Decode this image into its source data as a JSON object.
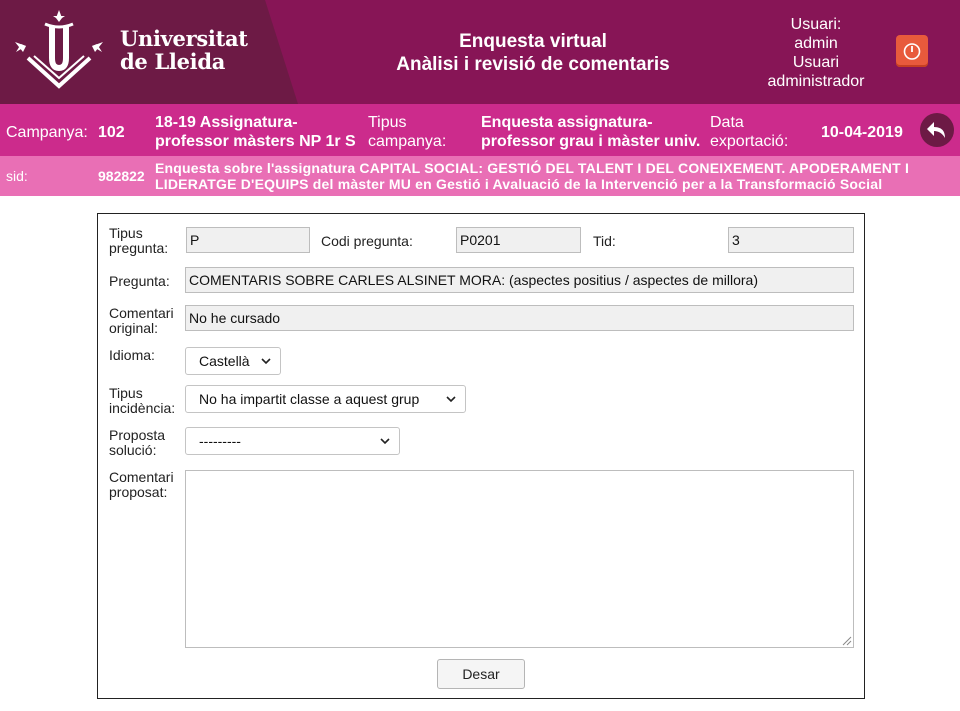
{
  "header": {
    "logo": {
      "line1": "Universitat",
      "line2": "de Lleida"
    },
    "title_line1": "Enquesta virtual",
    "title_line2": "Anàlisi i revisió de comentaris",
    "user": {
      "label": "Usuari:",
      "name": "admin",
      "role_line1": "Usuari",
      "role_line2": "administrador"
    },
    "logout_icon": "power-icon"
  },
  "campaign": {
    "label": "Campanya:",
    "number": "102",
    "name_line1": "18-19 Assignatura-",
    "name_line2": "professor màsters NP 1r S",
    "type_label_line1": "Tipus",
    "type_label_line2": "campanya:",
    "type_value_line1": "Enquesta assignatura-",
    "type_value_line2": "professor grau i màster univ.",
    "export_label_line1": "Data",
    "export_label_line2": "exportació:",
    "export_date": "10-04-2019",
    "back_icon": "back-arrow-icon"
  },
  "sid": {
    "label": "sid:",
    "value": "982822",
    "description": "Enquesta sobre l'assignatura CAPITAL SOCIAL: GESTIÓ DEL TALENT I DEL CONEIXEMENT. APODERAMENT I LIDERATGE D'EQUIPS del màster MU en Gestió i Avaluació de la Intervenció per a la Transformació Social"
  },
  "form": {
    "tipus_pregunta_label_line1": "Tipus",
    "tipus_pregunta_label_line2": "pregunta:",
    "tipus_pregunta_value": "P",
    "codi_pregunta_label": "Codi pregunta:",
    "codi_pregunta_value": "P0201",
    "tid_label": "Tid:",
    "tid_value": "3",
    "pregunta_label": "Pregunta:",
    "pregunta_value": "COMENTARIS SOBRE CARLES ALSINET MORA: (aspectes positius / aspectes de millora)",
    "comentari_original_label_line1": "Comentari",
    "comentari_original_label_line2": "original:",
    "comentari_original_value": "No he cursado",
    "idioma_label": "Idioma:",
    "idioma_selected": "Castellà",
    "tipus_incidencia_label_line1": "Tipus",
    "tipus_incidencia_label_line2": "incidència:",
    "tipus_incidencia_selected": "No ha impartit classe a aquest grup",
    "proposta_solucio_label_line1": "Proposta",
    "proposta_solucio_label_line2": "solució:",
    "proposta_solucio_selected": "---------",
    "comentari_proposat_label_line1": "Comentari",
    "comentari_proposat_label_line2": "proposat:",
    "comentari_proposat_value": "",
    "save_button": "Desar"
  },
  "colors": {
    "header_bg": "#871556",
    "logo_panel_bg": "#6d1a45",
    "campaign_bar_bg": "#cc2b8c",
    "sid_bar_bg": "#e96fb5",
    "logout_button": "#e85a3c"
  }
}
